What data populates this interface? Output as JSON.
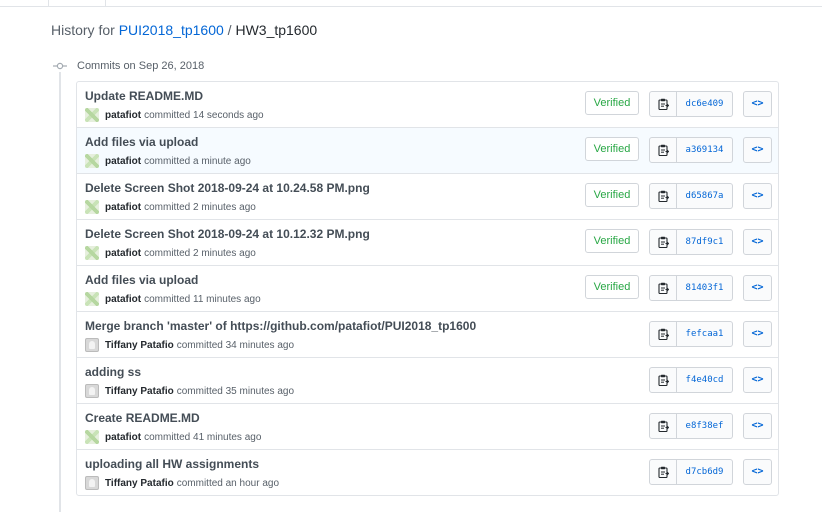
{
  "header": {
    "prefix": "History for ",
    "repo": "PUI2018_tp1600",
    "separator": " / ",
    "folder": "HW3_tp1600"
  },
  "group": {
    "date_label": "Commits on Sep 26, 2018"
  },
  "labels": {
    "verified": "Verified",
    "browse_icon": "<>"
  },
  "icons": {
    "copy": "clipboard-icon",
    "browse": "code-icon",
    "timeline": "commit-node-icon"
  },
  "colors": {
    "link": "#0366d6",
    "verified": "#28a745",
    "highlight_row": "#f6fbff"
  },
  "commits": [
    {
      "title": "Update README.MD",
      "author": "patafiot",
      "when": "committed 14 seconds ago",
      "verified": true,
      "sha": "dc6e409",
      "avatar": "identicon"
    },
    {
      "title": "Add files via upload",
      "author": "patafiot",
      "when": "committed a minute ago",
      "verified": true,
      "sha": "a369134",
      "avatar": "identicon"
    },
    {
      "title": "Delete Screen Shot 2018-09-24 at 10.24.58 PM.png",
      "author": "patafiot",
      "when": "committed 2 minutes ago",
      "verified": true,
      "sha": "d65867a",
      "avatar": "identicon"
    },
    {
      "title": "Delete Screen Shot 2018-09-24 at 10.12.32 PM.png",
      "author": "patafiot",
      "when": "committed 2 minutes ago",
      "verified": true,
      "sha": "87df9c1",
      "avatar": "identicon"
    },
    {
      "title": "Add files via upload",
      "author": "patafiot",
      "when": "committed 11 minutes ago",
      "verified": true,
      "sha": "81403f1",
      "avatar": "identicon"
    },
    {
      "title": "Merge branch 'master' of https://github.com/patafiot/PUI2018_tp1600",
      "author": "Tiffany Patafio",
      "when": "committed 34 minutes ago",
      "verified": false,
      "sha": "fefcaa1",
      "avatar": "photo"
    },
    {
      "title": "adding ss",
      "author": "Tiffany Patafio",
      "when": "committed 35 minutes ago",
      "verified": false,
      "sha": "f4e40cd",
      "avatar": "photo"
    },
    {
      "title": "Create README.MD",
      "author": "patafiot",
      "when": "committed 41 minutes ago",
      "verified": false,
      "sha": "e8f38ef",
      "avatar": "identicon"
    },
    {
      "title": "uploading all HW assignments",
      "author": "Tiffany Patafio",
      "when": "committed an hour ago",
      "verified": false,
      "sha": "d7cb6d9",
      "avatar": "photo"
    }
  ]
}
